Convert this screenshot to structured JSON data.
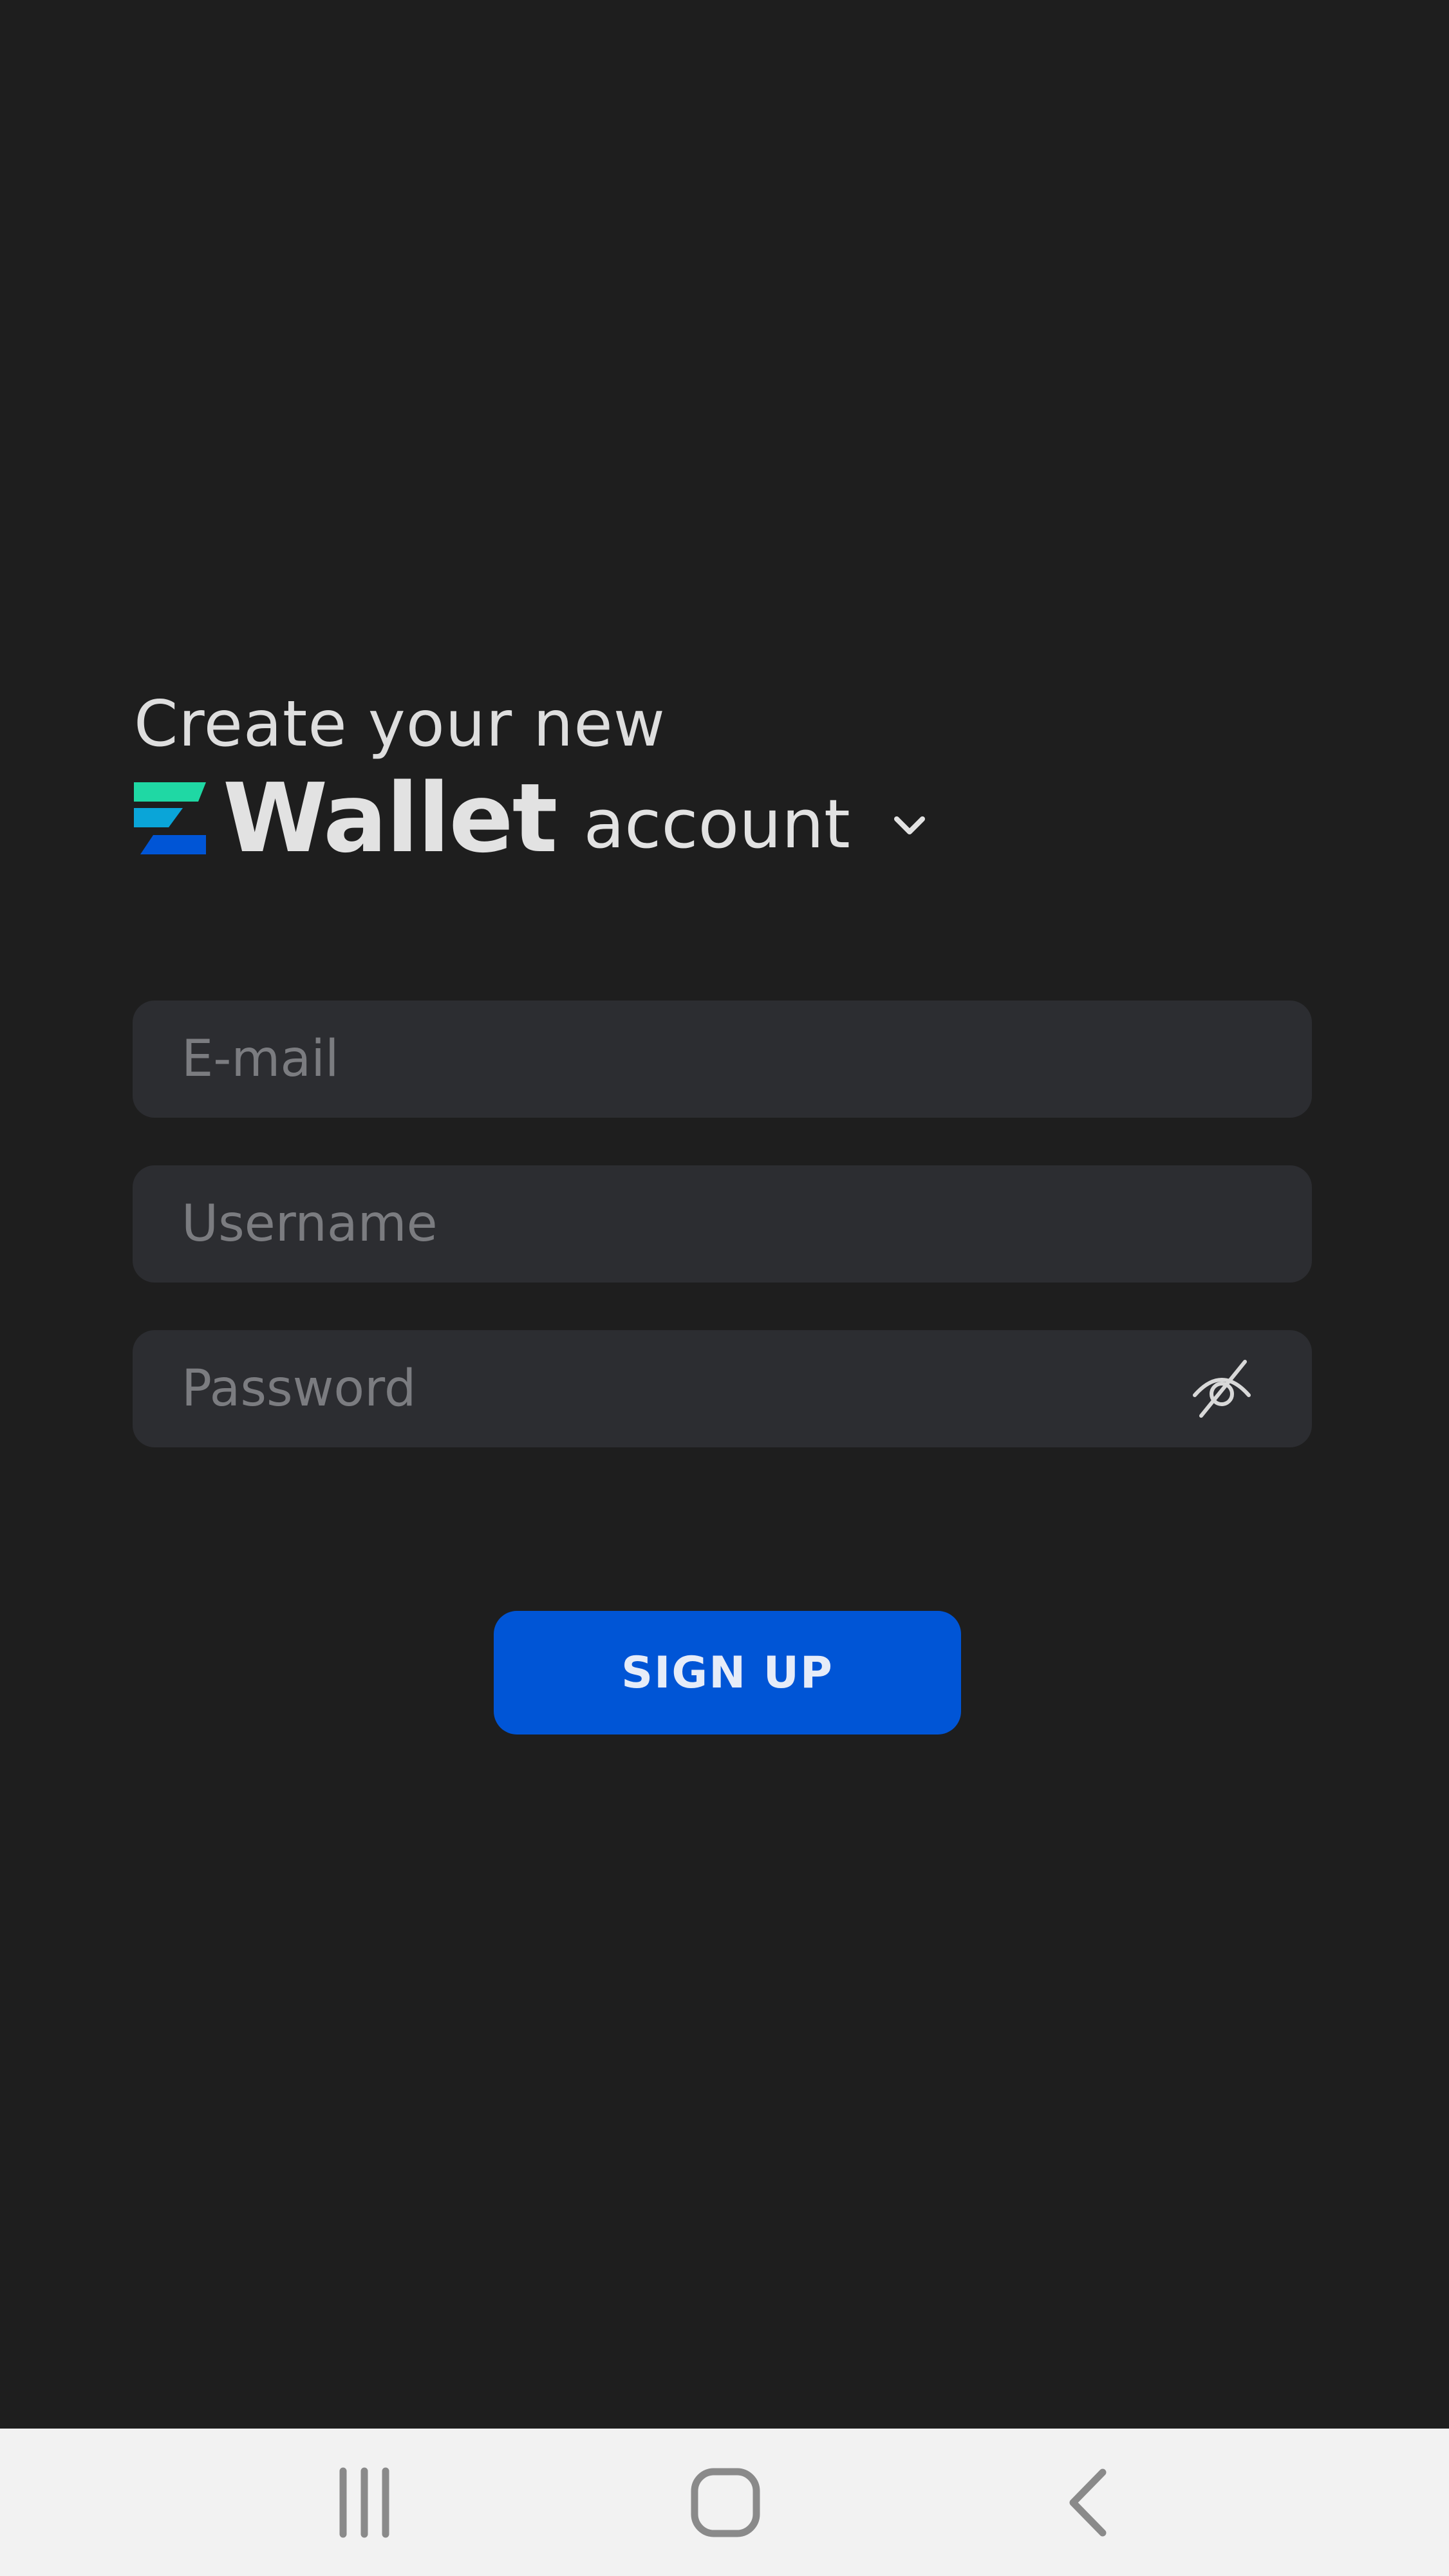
{
  "header": {
    "line1": "Create your new",
    "brand_name": "Wallet",
    "account_word": "account",
    "brand_colors": [
      "#1fd8a4",
      "#0aa5d8",
      "#0055d6"
    ]
  },
  "form": {
    "email_placeholder": "E-mail",
    "username_placeholder": "Username",
    "password_placeholder": "Password",
    "email_value": "",
    "username_value": "",
    "password_value": ""
  },
  "signup_button": {
    "label": "SIGN UP",
    "color": "#0055d6"
  },
  "icons": {
    "logo": "brand-logo-icon",
    "dropdown": "chevron-down-icon",
    "password_toggle": "eye-off-icon",
    "nav_recent": "recent-apps-icon",
    "nav_home": "home-icon",
    "nav_back": "back-icon"
  },
  "theme": {
    "background": "#1e1e1e",
    "field_background": "#2c2d31",
    "navbar_background": "#f2f2f2"
  }
}
